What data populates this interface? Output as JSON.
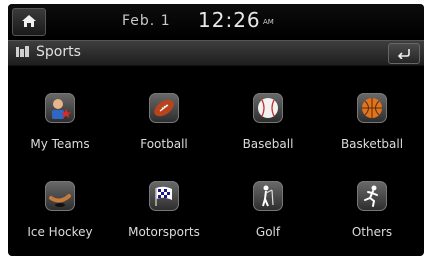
{
  "status": {
    "date": "Feb. 1",
    "time": "12:26",
    "ampm": "AM"
  },
  "header": {
    "title": "Sports"
  },
  "grid": {
    "items": [
      {
        "label": "My Teams",
        "icon": "my-teams-icon"
      },
      {
        "label": "Football",
        "icon": "football-icon"
      },
      {
        "label": "Baseball",
        "icon": "baseball-icon"
      },
      {
        "label": "Basketball",
        "icon": "basketball-icon"
      },
      {
        "label": "Ice Hockey",
        "icon": "ice-hockey-icon"
      },
      {
        "label": "Motorsports",
        "icon": "motorsports-icon"
      },
      {
        "label": "Golf",
        "icon": "golf-icon"
      },
      {
        "label": "Others",
        "icon": "others-icon"
      }
    ]
  }
}
